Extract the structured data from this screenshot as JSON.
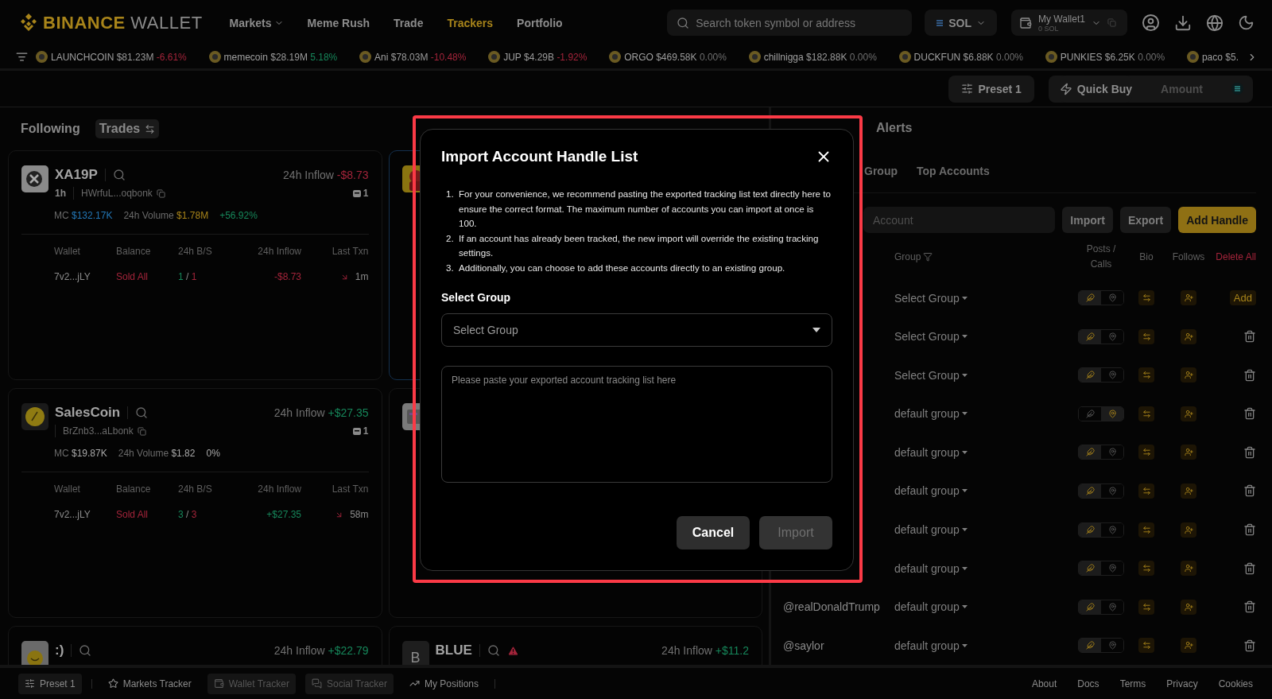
{
  "header": {
    "brand": "BINANCE",
    "product": "WALLET",
    "nav": [
      {
        "label": "Markets",
        "selected": false,
        "dropdown": true
      },
      {
        "label": "Meme Rush",
        "selected": false,
        "dropdown": false
      },
      {
        "label": "Trade",
        "selected": false,
        "dropdown": false
      },
      {
        "label": "Trackers",
        "selected": true,
        "dropdown": false
      },
      {
        "label": "Portfolio",
        "selected": false,
        "dropdown": false
      }
    ],
    "search": {
      "placeholder": "Search token symbol or address"
    },
    "chain": "SOL",
    "wallet": {
      "name": "My Wallet1",
      "balance": "0 SOL"
    }
  },
  "ticker": [
    {
      "name": "LAUNCHCOIN",
      "value": "$81.23M",
      "change": "-6.61%",
      "color": "#a3243a"
    },
    {
      "name": "memecoin",
      "value": "$28.19M",
      "change": "5.18%",
      "color": "#16865a"
    },
    {
      "name": "Ani",
      "value": "$78.03M",
      "change": "-10.48%",
      "color": "#a3243a"
    },
    {
      "name": "JUP",
      "value": "$4.29B",
      "change": "-1.92%",
      "color": "#a3243a"
    },
    {
      "name": "ORGO",
      "value": "$469.58K",
      "change": "0.00%",
      "color": "#6e6e6e"
    },
    {
      "name": "chillnigga",
      "value": "$182.88K",
      "change": "0.00%",
      "color": "#6e6e6e"
    },
    {
      "name": "DUCKFUN",
      "value": "$6.88K",
      "change": "0.00%",
      "color": "#6e6e6e"
    },
    {
      "name": "PUNKIES",
      "value": "$6.25K",
      "change": "0.00%",
      "color": "#6e6e6e"
    },
    {
      "name": "paco",
      "value": "$5."
    }
  ],
  "toolbar": {
    "preset": "Preset 1",
    "quick_buy": "Quick Buy",
    "amount_placeholder": "Amount"
  },
  "trades": {
    "tabs": [
      {
        "label": "Following",
        "selected": false
      },
      {
        "label": "Trades",
        "selected": true
      }
    ],
    "columns": [
      {
        "cards": [
          {
            "selected": false,
            "kind": "x-mark",
            "name": "XA19P",
            "age": "1h",
            "address": "HWrfuL...oqbonk",
            "inflow_label": "24h Inflow",
            "inflow": "-$8.73",
            "color": "#a3243a",
            "holders": "1",
            "stats": [
              {
                "label": "MC",
                "value": "$132.17K",
                "color": "#2376b5"
              },
              {
                "label": "24h Volume",
                "value": "$1.78M",
                "color": "#a8841a"
              },
              {
                "value": "+56.92%",
                "color": "#16865a"
              }
            ],
            "table": {
              "columns": [
                "Wallet",
                "Balance",
                "24h B/S",
                "24h Inflow",
                "Last Txn"
              ],
              "rows": [
                {
                  "wallet": "7v2...jLY",
                  "balance": "Sold All",
                  "buys": "1",
                  "separator": "/",
                  "sells": "1",
                  "inflow": "-$8.73",
                  "color": "#a3243a",
                  "last": "1m"
                }
              ]
            }
          },
          {
            "selected": false,
            "kind": "gold-coin",
            "name": "SalesCoin",
            "address": "BrZnb3...aLbonk",
            "inflow_label": "24h Inflow",
            "inflow": "+$27.35",
            "color": "#16865a",
            "holders": "1",
            "stats": [
              {
                "label": "MC",
                "value": "$19.87K",
                "color": "#a8a8a8"
              },
              {
                "label": "24h Volume",
                "value": "$1.82",
                "color": "#a8a8a8"
              },
              {
                "value": "0%",
                "color": "#a8a8a8"
              }
            ],
            "table": {
              "columns": [
                "Wallet",
                "Balance",
                "24h B/S",
                "24h Inflow",
                "Last Txn"
              ],
              "rows": [
                {
                  "wallet": "7v2...jLY",
                  "balance": "Sold All",
                  "buys": "3",
                  "separator": "/",
                  "sells": "3",
                  "inflow": "+$27.35",
                  "color": "#16865a",
                  "last": "58m"
                }
              ]
            }
          },
          {
            "selected": false,
            "kind": "smiley",
            "name": ":)",
            "inflow_label": "24h Inflow",
            "inflow": "+$22.79",
            "color": "#16865a"
          }
        ]
      },
      {
        "cards": [
          {
            "selected": true,
            "kind": "red-figure"
          },
          {
            "selected": false,
            "kind": "grey-card"
          },
          {
            "selected": false,
            "kind": "letter",
            "logo_text": "B",
            "name": "BLUE",
            "warning": true,
            "inflow_label": "24h Inflow",
            "inflow": "+$11.2",
            "color": "#16865a"
          }
        ]
      }
    ]
  },
  "following": {
    "tabs": [
      {
        "label": "Alerts",
        "selected": false
      }
    ],
    "subtabs": [
      {
        "label": "Group",
        "selected": false
      },
      {
        "label": "Top Accounts",
        "selected": false
      }
    ],
    "search": {
      "placeholder": "Account"
    },
    "buttons": [
      {
        "label": "Import",
        "kind": "secondary"
      },
      {
        "label": "Export",
        "kind": "secondary"
      },
      {
        "label": "Add Handle",
        "kind": "primary"
      }
    ],
    "columns": {
      "group": "Group",
      "posts_calls": "Posts / Calls",
      "bio": "Bio",
      "follows": "Follows",
      "delete_all": "Delete All"
    },
    "rows": [
      {
        "group": "Select Group",
        "posts": true,
        "calls": false,
        "kind": "add",
        "action_label": "Add"
      },
      {
        "group": "Select Group",
        "posts": true,
        "calls": false,
        "kind": "delete"
      },
      {
        "group": "Select Group",
        "posts": true,
        "calls": false,
        "kind": "delete"
      },
      {
        "group": "default group",
        "posts": false,
        "calls": true,
        "kind": "delete"
      },
      {
        "group": "default group",
        "posts": true,
        "calls": false,
        "kind": "delete"
      },
      {
        "group": "default group",
        "posts": true,
        "calls": false,
        "kind": "delete"
      },
      {
        "group": "default group",
        "posts": true,
        "calls": false,
        "kind": "delete"
      },
      {
        "group": "default group",
        "posts": true,
        "calls": false,
        "kind": "delete"
      },
      {
        "handle": "@realDonaldTrump",
        "group": "default group",
        "posts": true,
        "calls": false,
        "kind": "delete"
      },
      {
        "handle": "@saylor",
        "group": "default group",
        "posts": true,
        "calls": false,
        "kind": "delete"
      }
    ]
  },
  "modal": {
    "highlighted": true,
    "title": "Import Account Handle List",
    "instructions": [
      {
        "number": "1.",
        "text": "For your convenience, we recommend pasting the exported tracking list text directly here to ensure the correct format. The maximum number of accounts you can import at once is 100."
      },
      {
        "number": "2.",
        "text": "If an account has already been tracked, the new import will override the existing tracking settings."
      },
      {
        "number": "3.",
        "text": "Additionally, you can choose to add these accounts directly to an existing group."
      }
    ],
    "group_label": "Select Group",
    "group_placeholder": "Select Group",
    "list_placeholder": "Please paste your exported account tracking list here",
    "buttons": [
      {
        "label": "Cancel",
        "disabled": false
      },
      {
        "label": "Import",
        "disabled": true
      }
    ]
  },
  "footer": {
    "preset": "Preset 1",
    "trackers": [
      {
        "label": "Markets Tracker",
        "pinned": false
      },
      {
        "label": "Wallet Tracker",
        "pinned": true
      },
      {
        "label": "Social Tracker",
        "pinned": true
      },
      {
        "label": "My Positions",
        "pinned": false
      }
    ],
    "links": [
      "About",
      "Docs",
      "Terms",
      "Privacy",
      "Cookies"
    ]
  }
}
